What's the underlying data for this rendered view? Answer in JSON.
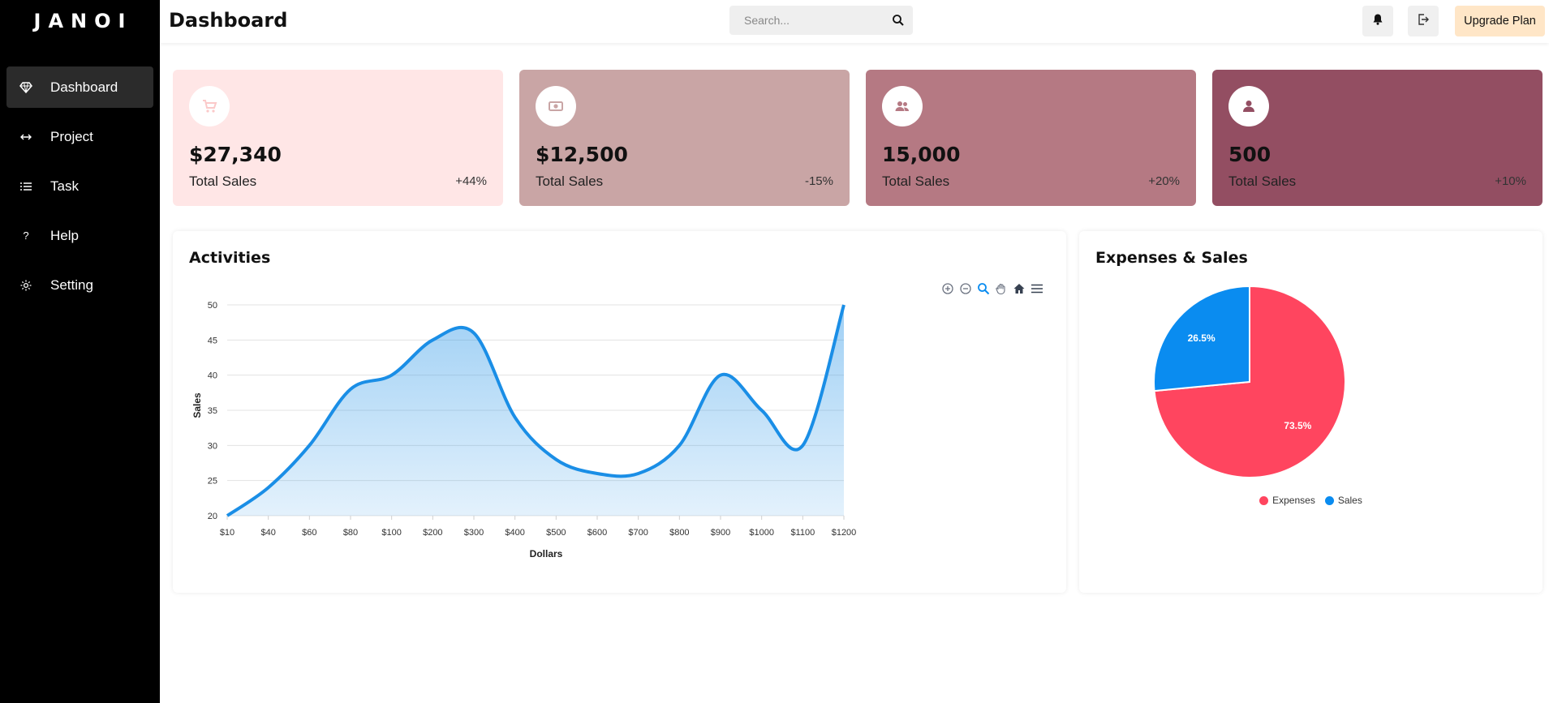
{
  "app": {
    "logo": "JANOI"
  },
  "sidebar": {
    "items": [
      {
        "label": "Dashboard",
        "icon": "diamond-icon",
        "active": true
      },
      {
        "label": "Project",
        "icon": "code-arrows-icon"
      },
      {
        "label": "Task",
        "icon": "list-icon"
      },
      {
        "label": "Help",
        "icon": "question-icon"
      },
      {
        "label": "Setting",
        "icon": "gear-icon"
      }
    ]
  },
  "header": {
    "title": "Dashboard",
    "search_placeholder": "Search...",
    "upgrade_label": "Upgrade Plan"
  },
  "cards": [
    {
      "value": "$27,340",
      "label": "Total Sales",
      "change": "+44%",
      "icon": "cart-icon",
      "bg": "#ffe6e6",
      "icon_color": "#fbc9c9"
    },
    {
      "value": "$12,500",
      "label": "Total Sales",
      "change": "-15%",
      "icon": "money-icon",
      "bg": "#c9a5a5",
      "icon_color": "#c9a5a5"
    },
    {
      "value": "15,000",
      "label": "Total Sales",
      "change": "+20%",
      "icon": "users-icon",
      "bg": "#b57983",
      "icon_color": "#b57983"
    },
    {
      "value": "500",
      "label": "Total Sales",
      "change": "+10%",
      "icon": "user-icon",
      "bg": "#934e62",
      "icon_color": "#934e62"
    }
  ],
  "activities": {
    "title": "Activities",
    "toolbar_icons": [
      "zoom-in-icon",
      "zoom-out-icon",
      "magnifier-icon",
      "pan-hand-icon",
      "home-icon",
      "menu-icon"
    ]
  },
  "expenses": {
    "title": "Expenses & Sales"
  },
  "chart_data": [
    {
      "type": "area",
      "title": "Activities",
      "xlabel": "Dollars",
      "ylabel": "Sales",
      "categories": [
        "$10",
        "$40",
        "$60",
        "$80",
        "$100",
        "$200",
        "$300",
        "$400",
        "$500",
        "$600",
        "$700",
        "$800",
        "$900",
        "$1000",
        "$1100",
        "$1200"
      ],
      "series": [
        {
          "values": [
            20,
            24,
            30,
            38,
            40,
            45,
            46,
            34,
            28,
            26,
            26,
            30,
            40,
            35,
            30,
            50
          ]
        }
      ],
      "ylim": [
        20,
        50
      ],
      "yticks": [
        20,
        25,
        30,
        35,
        40,
        45,
        50
      ],
      "grid": true,
      "color": "#1a8ee6"
    },
    {
      "type": "pie",
      "title": "Expenses & Sales",
      "labels": [
        "Expenses",
        "Sales"
      ],
      "values": [
        73.5,
        26.5
      ],
      "value_labels": [
        "73.5%",
        "26.5%"
      ],
      "colors": [
        "#ff455f",
        "#0a8cf0"
      ],
      "legend": "bottom"
    }
  ]
}
